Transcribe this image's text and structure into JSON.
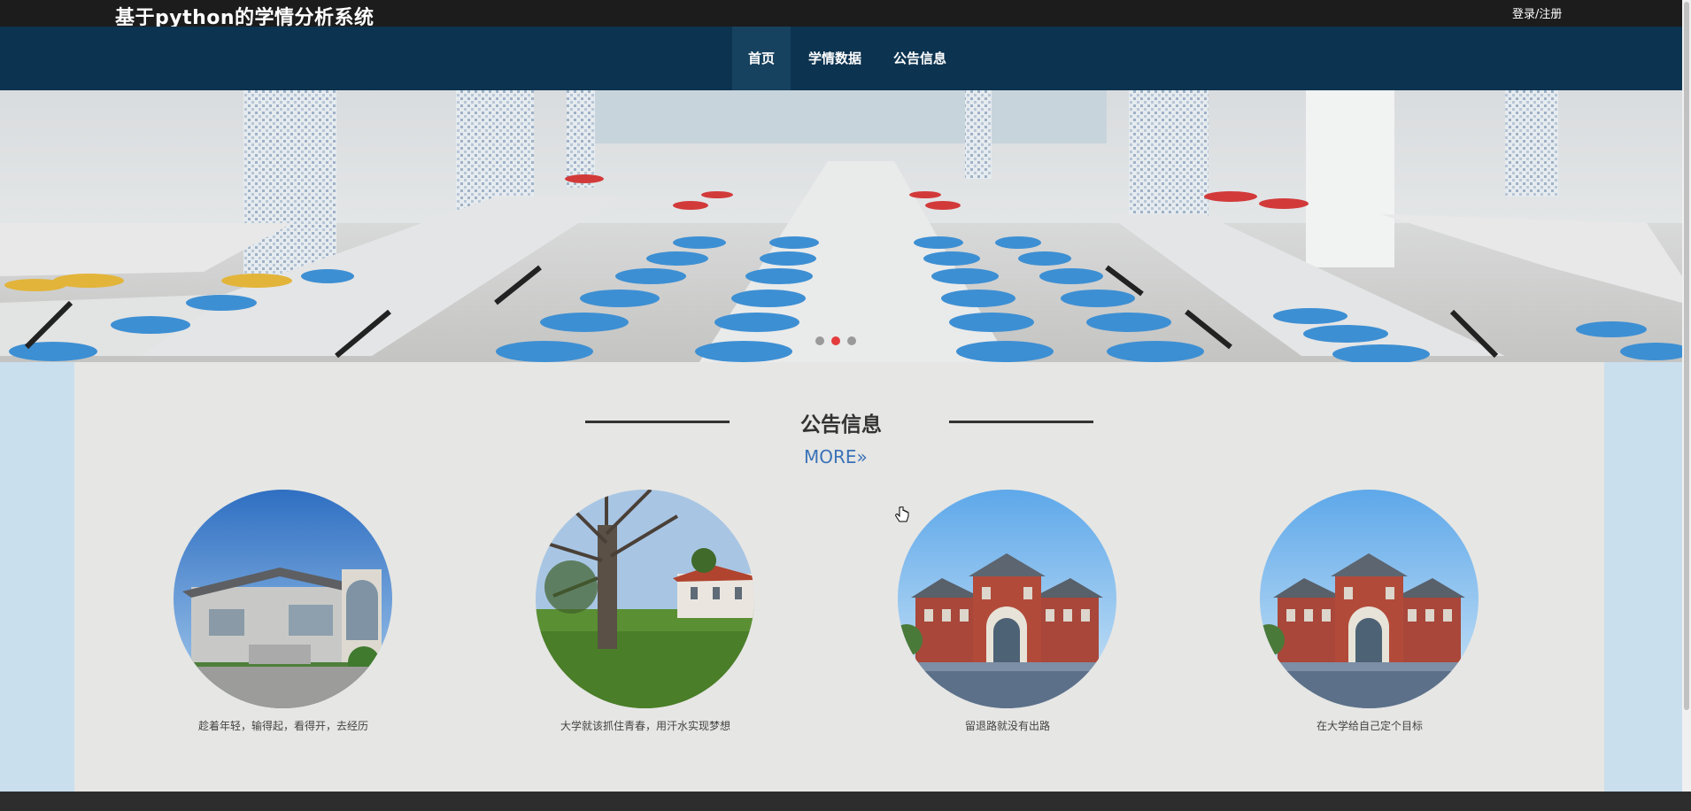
{
  "header": {
    "site_title": "基于python的学情分析系统",
    "login_label": "登录/注册"
  },
  "nav": {
    "items": [
      {
        "label": "首页",
        "active": true
      },
      {
        "label": "学情数据",
        "active": false
      },
      {
        "label": "公告信息",
        "active": false
      }
    ]
  },
  "banner": {
    "slide_count": 3,
    "active_slide": 2,
    "active_dot_color": "#e43c3c",
    "dot_color": "#9a9a9a"
  },
  "announcements": {
    "section_title": "公告信息",
    "more_label": "MORE»",
    "items": [
      {
        "caption": "趁着年轻，输得起，看得开，去经历",
        "image": "modern-building-photo"
      },
      {
        "caption": "大学就该抓住青春，用汗水实现梦想",
        "image": "campus-tree-photo"
      },
      {
        "caption": "留退路就没有出路",
        "image": "red-brick-building-photo"
      },
      {
        "caption": "在大学给自己定个目标",
        "image": "red-brick-building-photo"
      }
    ]
  },
  "colors": {
    "topbar": "#1c1c1c",
    "navbar": "#0c3350",
    "nav_active": "#16425f",
    "panel": "#e6e6e4",
    "page_bg": "#c9dfee",
    "more_link": "#3a72b8"
  }
}
